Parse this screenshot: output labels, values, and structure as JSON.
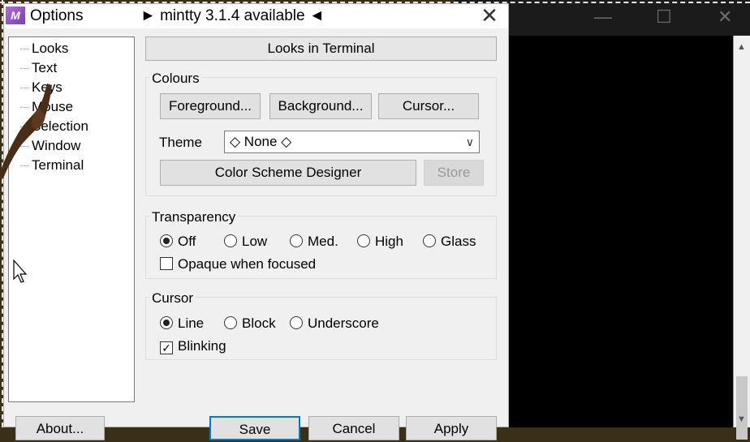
{
  "dialog": {
    "title": "Options",
    "update_notice": "► mintty 3.1.4 available ◄",
    "close_glyph": "✕",
    "app_icon_text": "M"
  },
  "tree": {
    "items": [
      {
        "label": "Looks"
      },
      {
        "label": "Text"
      },
      {
        "label": "Keys"
      },
      {
        "label": "Mouse"
      },
      {
        "label": "Selection"
      },
      {
        "label": "Window"
      },
      {
        "label": "Terminal"
      }
    ]
  },
  "panel": {
    "header": "Looks in Terminal",
    "colours": {
      "label": "Colours",
      "foreground": "Foreground...",
      "background": "Background...",
      "cursor": "Cursor...",
      "theme_label": "Theme",
      "theme_value": "◇ None ◇",
      "designer": "Color Scheme Designer",
      "store": "Store"
    },
    "transparency": {
      "label": "Transparency",
      "options": [
        "Off",
        "Low",
        "Med.",
        "High",
        "Glass"
      ],
      "selected": "Off",
      "opaque_label": "Opaque when focused",
      "opaque_checked": false
    },
    "cursor": {
      "label": "Cursor",
      "options": [
        "Line",
        "Block",
        "Underscore"
      ],
      "selected": "Line",
      "blinking_label": "Blinking",
      "blinking_checked": true
    }
  },
  "footer": {
    "about": "About...",
    "save": "Save",
    "cancel": "Cancel",
    "apply": "Apply"
  },
  "terminal": {
    "minimize": "—",
    "maximize": "☐",
    "close": "✕"
  }
}
